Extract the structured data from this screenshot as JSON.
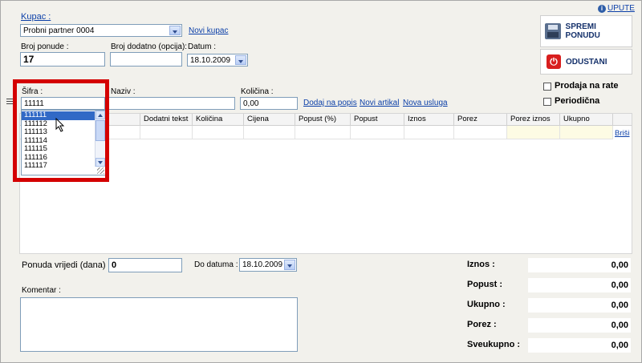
{
  "header": {
    "kupac_label": "Kupac :",
    "kupac_value": "Probni partner 0004",
    "novi_kupac": "Novi kupac",
    "upute": "UPUTE",
    "broj_ponude_label": "Broj ponude :",
    "broj_ponude_value": "17",
    "broj_dodatno_label": "Broj dodatno (opcija):",
    "broj_dodatno_value": "",
    "datum_label": "Datum :",
    "datum_value": "18.10.2009"
  },
  "actions": {
    "spremi": "SPREMI PONUDU",
    "odustani": "ODUSTANI",
    "prodaja_na_rate": "Prodaja na rate",
    "periodicna": "Periodična"
  },
  "item_entry": {
    "sifra_label": "Šifra :",
    "sifra_value": "11111",
    "naziv_label": "Naziv :",
    "naziv_value": "",
    "kolicina_label": "Količina :",
    "kolicina_value": "0,00",
    "dodaj_na_popis": "Dodaj na popis",
    "novi_artikal": "Novi artikal",
    "nova_usluga": "Nova usluga",
    "autocomplete": [
      "111111",
      "111112",
      "111113",
      "111114",
      "111115",
      "111116",
      "111117"
    ]
  },
  "grid": {
    "columns": [
      "Dodatni tekst",
      "Količina",
      "Cijena",
      "Popust (%)",
      "Popust",
      "Iznos",
      "Porez",
      "Porez iznos",
      "Ukupno"
    ],
    "delete_link": "Briši"
  },
  "footer": {
    "ponuda_vrijedi_label": "Ponuda vrijedi (dana) :",
    "ponuda_vrijedi_value": "0",
    "do_datuma_label": "Do datuma :",
    "do_datuma_value": "18.10.2009",
    "komentar_label": "Komentar :",
    "komentar_value": ""
  },
  "totals": [
    {
      "label": "Iznos :",
      "value": "0,00"
    },
    {
      "label": "Popust :",
      "value": "0,00"
    },
    {
      "label": "Ukupno :",
      "value": "0,00"
    },
    {
      "label": "Porez :",
      "value": "0,00"
    },
    {
      "label": "Sveukupno :",
      "value": "0,00"
    }
  ],
  "colors": {
    "highlight": "#d40000",
    "link": "#0b3fa8",
    "selection": "#3169c6"
  }
}
